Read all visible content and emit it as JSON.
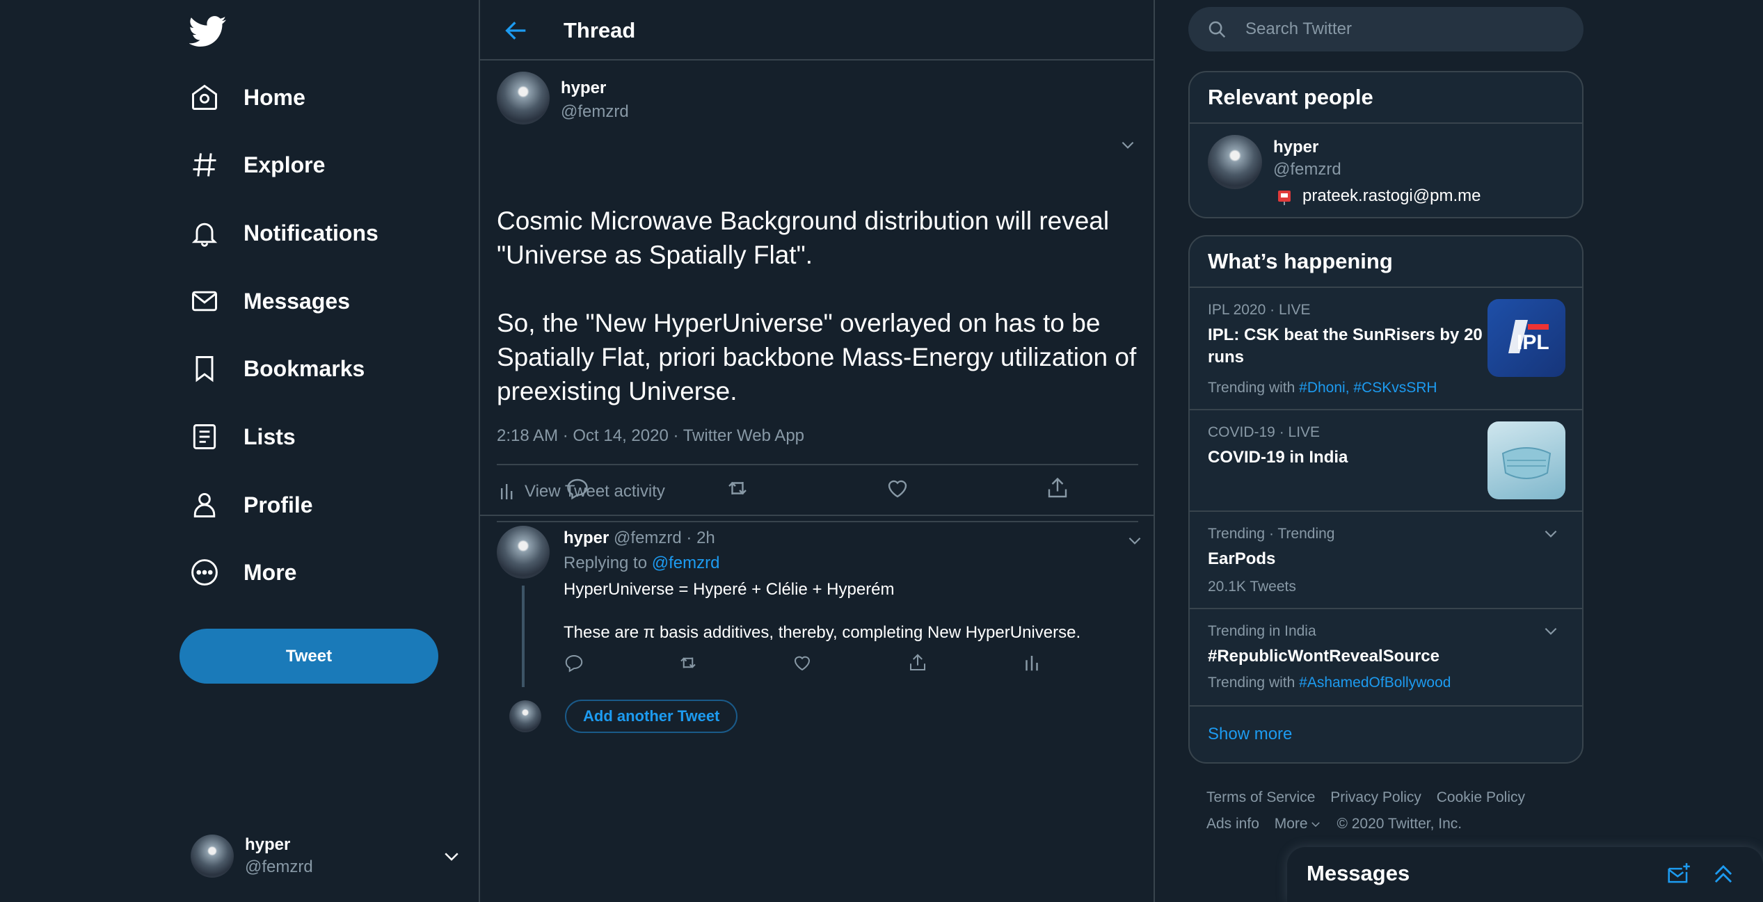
{
  "nav": {
    "items": [
      {
        "label": "Home",
        "icon": "home-icon"
      },
      {
        "label": "Explore",
        "icon": "hashtag-icon"
      },
      {
        "label": "Notifications",
        "icon": "bell-icon"
      },
      {
        "label": "Messages",
        "icon": "envelope-icon"
      },
      {
        "label": "Bookmarks",
        "icon": "bookmark-icon"
      },
      {
        "label": "Lists",
        "icon": "list-icon"
      },
      {
        "label": "Profile",
        "icon": "person-icon"
      },
      {
        "label": "More",
        "icon": "more-circle-icon"
      }
    ],
    "tweet_button": "Tweet"
  },
  "account": {
    "name": "hyper",
    "handle": "@femzrd"
  },
  "thread": {
    "title": "Thread",
    "main": {
      "name": "hyper",
      "handle": "@femzrd",
      "text": "Cosmic Microwave Background distribution will reveal \"Universe as Spatially Flat\".\n\nSo, the \"New HyperUniverse\" overlayed on has to be Spatially Flat, priori backbone Mass-Energy utilization of preexisting Universe.",
      "meta": "2:18 AM · Oct 14, 2020 · Twitter Web App",
      "activity_label": "View Tweet activity"
    },
    "reply": {
      "name": "hyper",
      "handle_time": "@femzrd · 2h",
      "replying_prefix": "Replying to",
      "replying_to": "@femzrd",
      "text": "HyperUniverse = Hyperé + Clélie + Hyperém\n\nThese are π basis additives, thereby, completing New HyperUniverse."
    },
    "add_another": "Add another Tweet"
  },
  "search": {
    "placeholder": "Search Twitter"
  },
  "relevant": {
    "title": "Relevant people",
    "name": "hyper",
    "handle": "@femzrd",
    "bio": "prateek.rastogi@pm.me"
  },
  "happening": {
    "title": "What’s happening",
    "trends": [
      {
        "meta": "IPL 2020 · LIVE",
        "title": "IPL: CSK beat the SunRisers by 20 runs",
        "sub_prefix": "Trending with",
        "tags": "#Dhoni, #CSKvsSRH"
      },
      {
        "meta": "COVID-19 · LIVE",
        "title": "COVID-19 in India"
      },
      {
        "meta": "Trending · Trending",
        "title": "EarPods",
        "sub": "20.1K Tweets"
      },
      {
        "meta": "Trending in India",
        "title": "#RepublicWontRevealSource",
        "sub_prefix": "Trending with",
        "tags": "#AshamedOfBollywood"
      }
    ],
    "show_more": "Show more"
  },
  "footer": {
    "links": [
      "Terms of Service",
      "Privacy Policy",
      "Cookie Policy",
      "Ads info",
      "More"
    ],
    "copyright": "© 2020 Twitter, Inc."
  },
  "messages_dock": {
    "title": "Messages"
  },
  "colors": {
    "background": "#15202b",
    "accent": "#1d9bf0",
    "button": "#1a7ab9",
    "muted": "#8899a6",
    "border": "#38444d"
  }
}
